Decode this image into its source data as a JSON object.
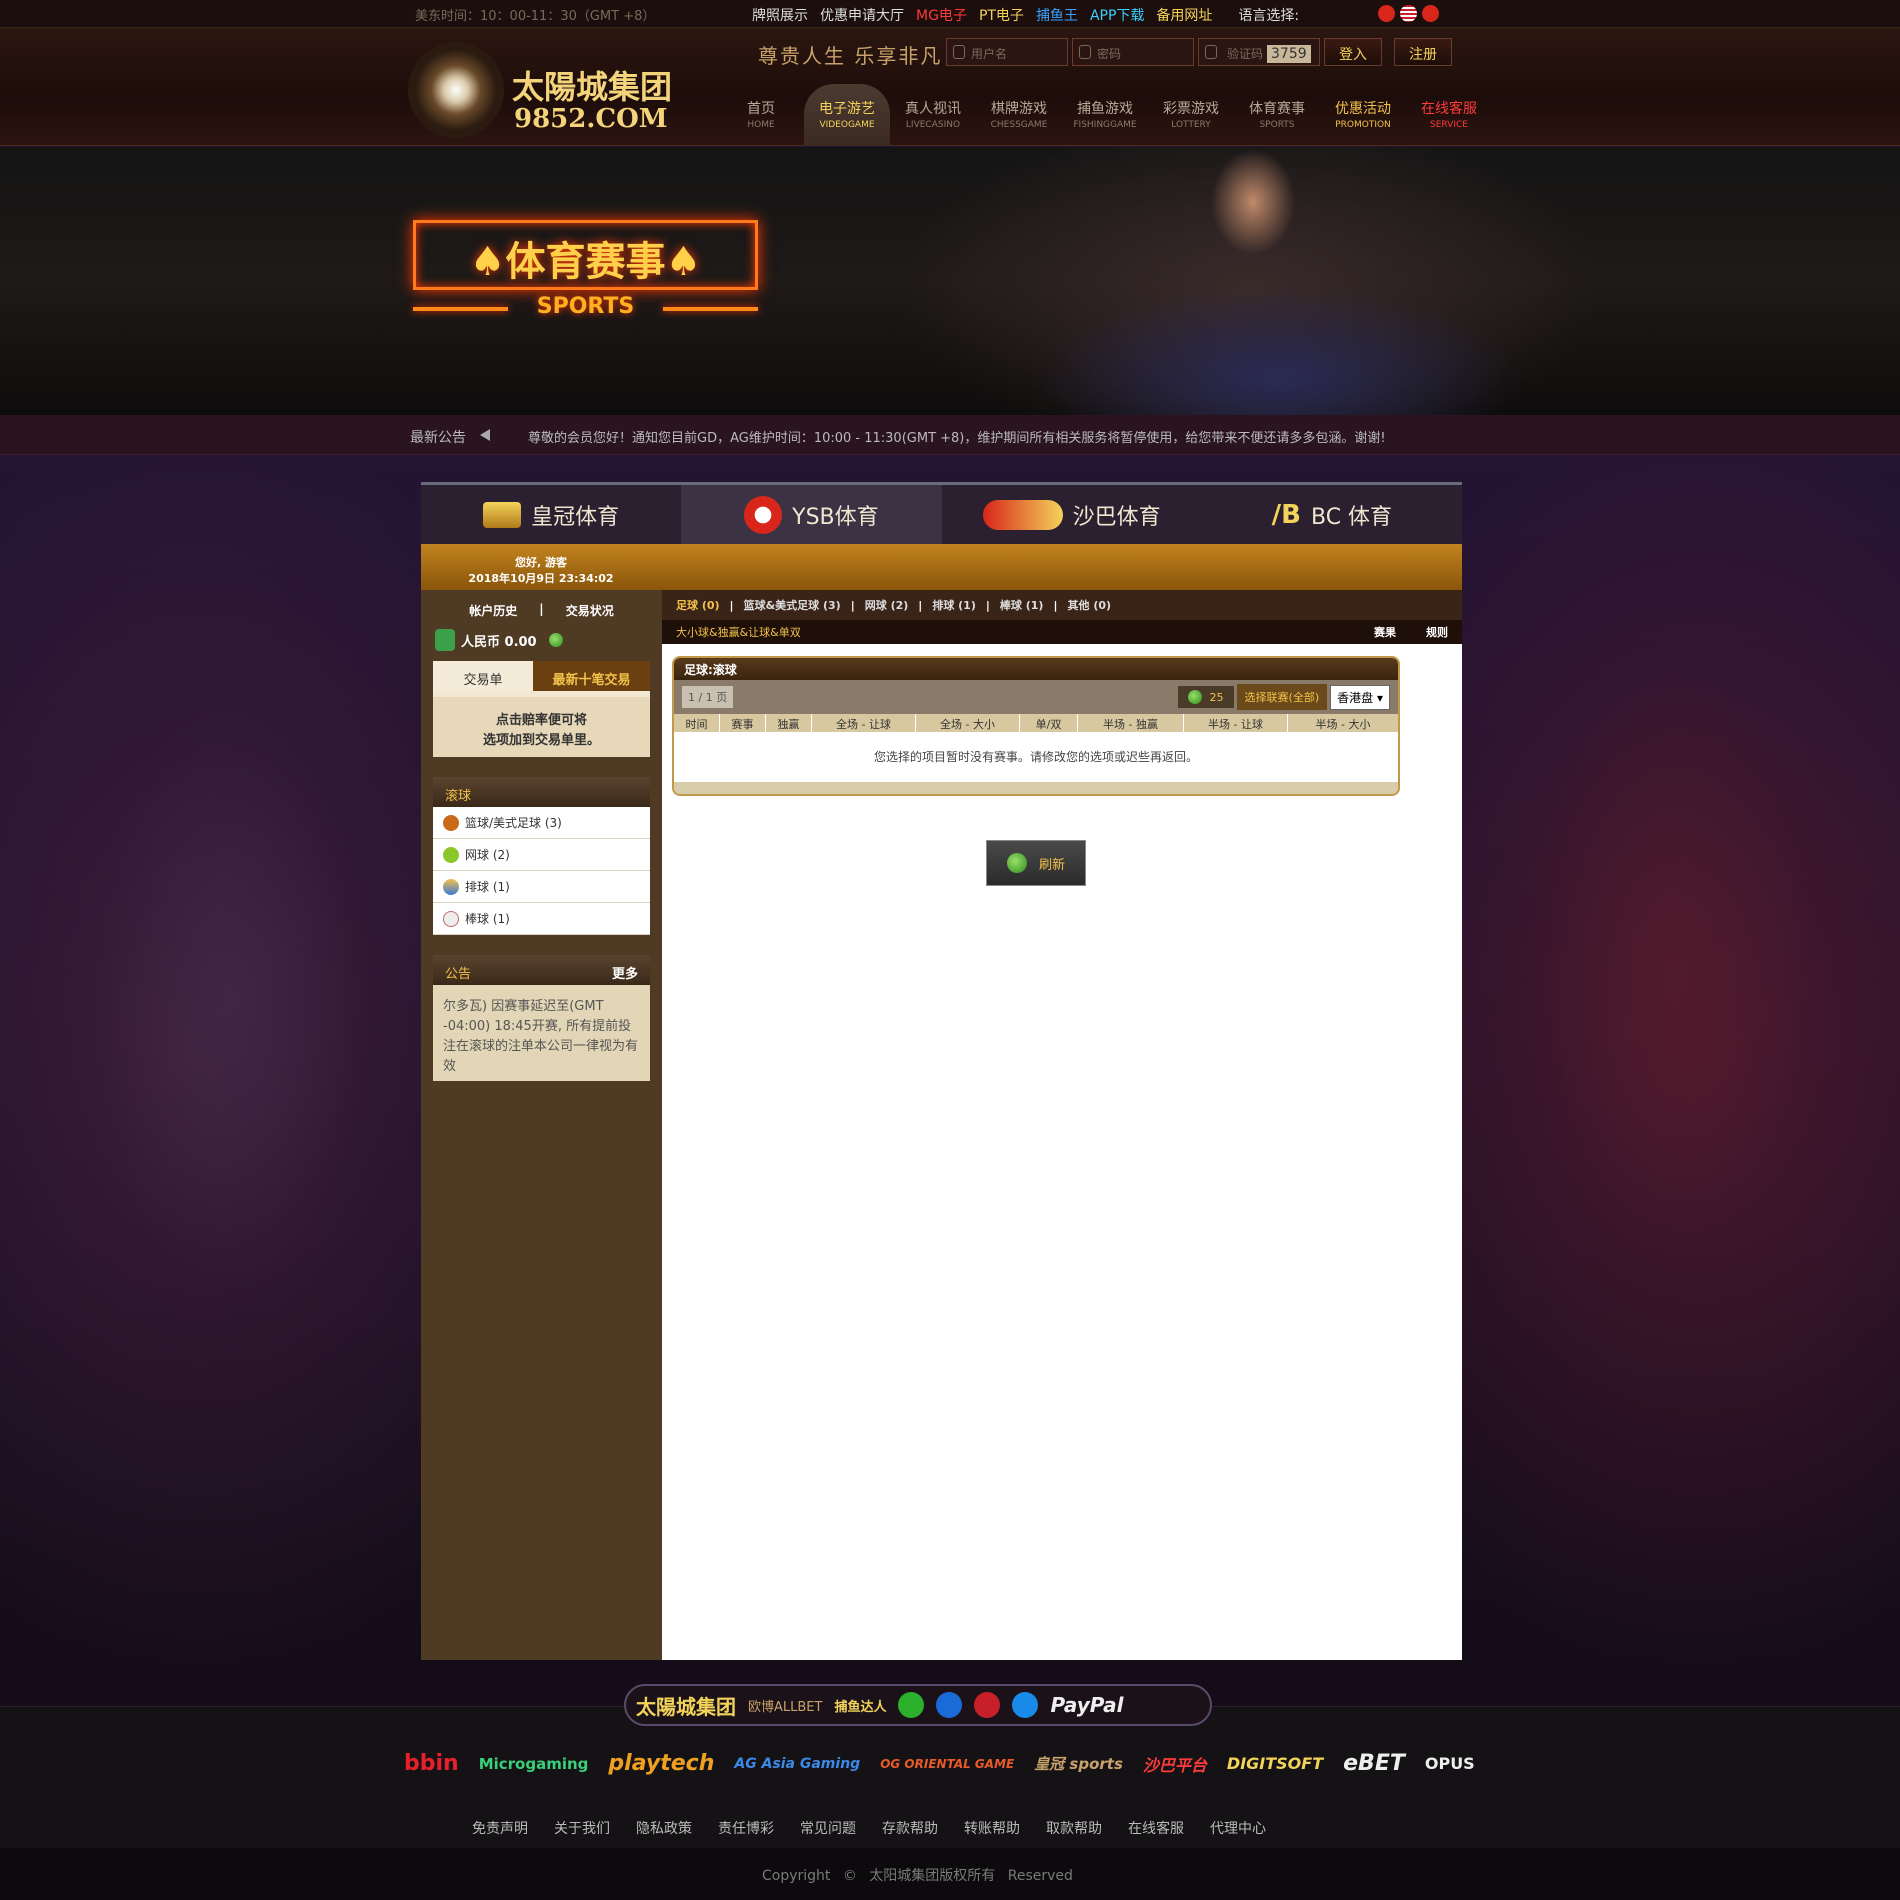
{
  "topbar": {
    "time": "美东时间：10：00-11：30（GMT +8）",
    "links": [
      "牌照展示",
      "优惠申请大厅",
      "MG电子",
      "PT电子",
      "捕鱼王",
      "APP下载",
      "备用网址",
      "语言选择:"
    ],
    "link_colors": [
      "#dddddd",
      "#dddddd",
      "#ff3a3a",
      "#f3d35a",
      "#3aa0ff",
      "#3ad0ff",
      "#f3d35a",
      "#ffffff"
    ]
  },
  "header": {
    "logo_title": "太陽城集团",
    "logo_domain": "9852.COM",
    "slogan": "尊贵人生 乐享非凡",
    "username_placeholder": "用户名",
    "password_placeholder": "密码",
    "captcha_placeholder": "验证码",
    "captcha_value": "3759",
    "login_label": "登入",
    "register_label": "注册",
    "nav": [
      {
        "zh": "首页",
        "en": "HOME"
      },
      {
        "zh": "电子游艺",
        "en": "VIDEOGAME"
      },
      {
        "zh": "真人视讯",
        "en": "LIVECASINO"
      },
      {
        "zh": "棋牌游戏",
        "en": "CHESSGAME"
      },
      {
        "zh": "捕鱼游戏",
        "en": "FISHINGGAME"
      },
      {
        "zh": "彩票游戏",
        "en": "LOTTERY"
      },
      {
        "zh": "体育赛事",
        "en": "SPORTS"
      },
      {
        "zh": "优惠活动",
        "en": "PROMOTION"
      },
      {
        "zh": "在线客服",
        "en": "SERVICE"
      }
    ]
  },
  "banner": {
    "title": "♠体育赛事♠",
    "subtitle": "SPORTS"
  },
  "notice": {
    "label": "最新公告",
    "message": "尊敬的会员您好！通知您目前GD，AG维护时间：10:00 - 11:30(GMT +8)，维护期间所有相关服务将暂停使用，给您带来不便还请多多包涵。谢谢!"
  },
  "sports": {
    "tabs": [
      "皇冠体育",
      "YSB体育",
      "沙巴体育",
      "BC 体育"
    ],
    "greeting": "您好, 游客",
    "datetime": "2018年10月9日 23:34:02",
    "account_history": "帐户历史",
    "account_sep": "|",
    "trade_status": "交易状况",
    "balance": "人民币 0.00",
    "slip_tab_1": "交易单",
    "slip_tab_2": "最新十笔交易",
    "slip_hint_1": "点击赔率便可将",
    "slip_hint_2": "选项加到交易单里。",
    "live_header": "滚球",
    "live_items": [
      "篮球/美式足球 (3)",
      "网球 (2)",
      "排球 (1)",
      "棒球 (1)"
    ],
    "news_header": "公告",
    "news_more": "更多",
    "news_text": "尔多瓦) 因赛事延迟至(GMT -04:00) 18:45开赛, 所有提前投注在滚球的注单本公司一律视为有效",
    "sub_tabs": [
      "足球 (0)",
      "篮球&美式足球 (3)",
      "网球 (2)",
      "排球 (1)",
      "棒球 (1)",
      "其他 (0)"
    ],
    "sub2_left": "大小球&独赢&让球&单双",
    "sub2_right": [
      "赛果",
      "规则"
    ],
    "odds_title": "足球:滚球",
    "pager": "1 / 1 页",
    "timer": "25",
    "league_select": "选择联赛(全部)",
    "odds_type": "香港盘",
    "columns": [
      "时间",
      "赛事",
      "独赢",
      "全场 - 让球",
      "全场 - 大小",
      "单/双",
      "半场 - 独赢",
      "半场 - 让球",
      "半场 - 大小"
    ],
    "empty_msg": "您选择的项目暂时没有赛事。请修改您的选项或迟些再返回。",
    "refresh": "刷新"
  },
  "footer": {
    "pay_brand": "太陽城集团",
    "pay_items": [
      "欧博ALLBET",
      "捕鱼达人"
    ],
    "paypal": "PayPal",
    "providers": [
      "bbin",
      "Microgaming",
      "playtech",
      "AG Asia Gaming",
      "OG ORIENTAL GAME",
      "皇冠 sports",
      "沙巴平台",
      "DIGITSOFT",
      "eBET",
      "OPUS"
    ],
    "links": [
      "免责声明",
      "关于我们",
      "隐私政策",
      "责任博彩",
      "常见问题",
      "存款帮助",
      "转账帮助",
      "取款帮助",
      "在线客服",
      "代理中心"
    ],
    "copyright": "Copyright © 太阳城集团版权所有 Reserved"
  }
}
